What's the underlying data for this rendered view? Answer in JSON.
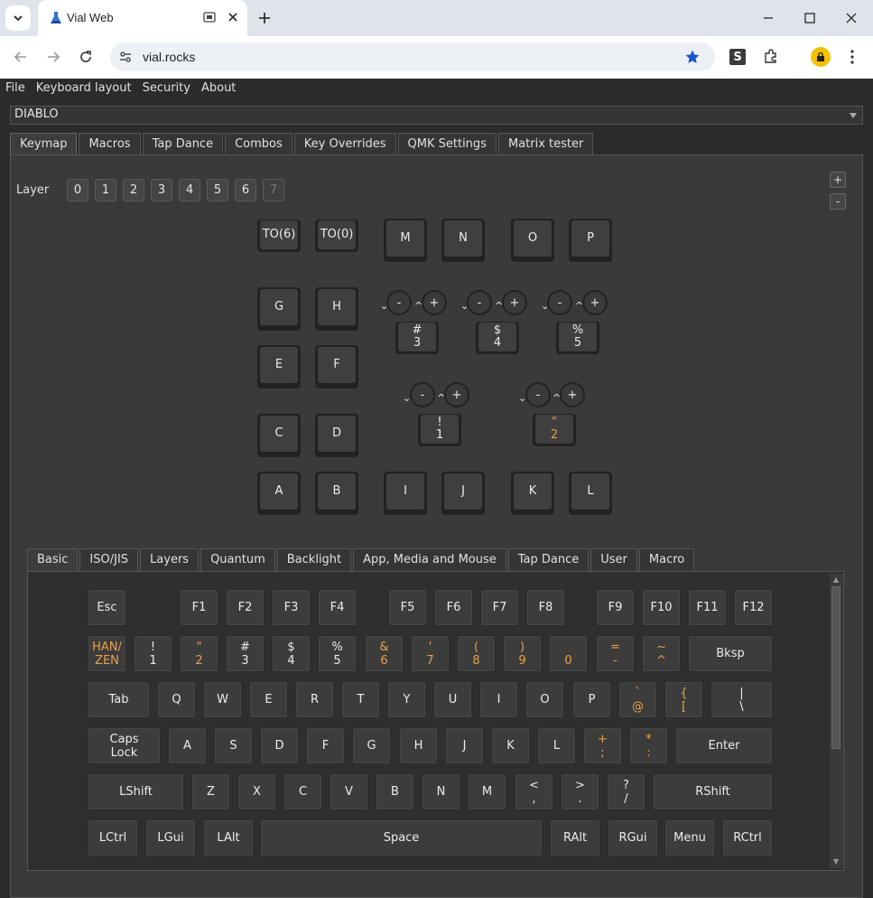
{
  "browser": {
    "tab_title": "Vial Web",
    "url": "vial.rocks"
  },
  "menu": [
    "File",
    "Keyboard layout",
    "Security",
    "About"
  ],
  "device": "DIABLO",
  "main_tabs": [
    "Keymap",
    "Macros",
    "Tap Dance",
    "Combos",
    "Key Overrides",
    "QMK Settings",
    "Matrix tester"
  ],
  "layer": {
    "label": "Layer",
    "buttons": [
      "0",
      "1",
      "2",
      "3",
      "4",
      "5",
      "6",
      "7"
    ],
    "plus": "+",
    "minus": "-"
  },
  "keymap": {
    "to6": "TO(6)",
    "to0": "TO(0)",
    "M": "M",
    "N": "N",
    "O": "O",
    "P": "P",
    "G": "G",
    "H": "H",
    "E": "E",
    "F": "F",
    "C": "C",
    "D": "D",
    "A": "A",
    "B": "B",
    "I": "I",
    "J": "J",
    "K": "K",
    "L": "L",
    "enc_minus": "-",
    "enc_plus": "+",
    "enc3_top": "#",
    "enc3_bot": "3",
    "enc4_top": "$",
    "enc4_bot": "4",
    "enc5_top": "%",
    "enc5_bot": "5",
    "enc1_top": "!",
    "enc1_bot": "1",
    "enc2_top": "\"",
    "enc2_bot": "2"
  },
  "key_tabs": [
    "Basic",
    "ISO/JIS",
    "Layers",
    "Quantum",
    "Backlight",
    "App, Media and Mouse",
    "Tap Dance",
    "User",
    "Macro"
  ],
  "keyboard": {
    "esc": "Esc",
    "f1": "F1",
    "f2": "F2",
    "f3": "F3",
    "f4": "F4",
    "f5": "F5",
    "f6": "F6",
    "f7": "F7",
    "f8": "F8",
    "f9": "F9",
    "f10": "F10",
    "f11": "F11",
    "f12": "F12",
    "hanzen": "HAN/\nZEN",
    "n1": "!\n1",
    "n2": "\"\n2",
    "n3": "#\n3",
    "n4": "$\n4",
    "n5": "%\n5",
    "n6": "&\n6",
    "n7": "'\n7",
    "n8": "(\n8",
    "n9": ")\n9",
    "n0": "0",
    "minus": "=\n-",
    "caret": "~\n^",
    "bksp": "Bksp",
    "tab": "Tab",
    "q": "Q",
    "w": "W",
    "e": "E",
    "r": "R",
    "t": "T",
    "y": "Y",
    "u": "U",
    "i": "I",
    "o": "O",
    "p": "P",
    "at": "`\n@",
    "lbracket": "{\n[",
    "backslash": "|\n\\",
    "caps": "Caps\nLock",
    "a": "A",
    "s": "S",
    "d": "D",
    "f": "F",
    "g": "G",
    "h": "H",
    "j": "J",
    "k": "K",
    "l": "L",
    "semicolon": "+\n;",
    "colon": "*\n:",
    "enter": "Enter",
    "lshift": "LShift",
    "z": "Z",
    "x": "X",
    "c": "C",
    "v": "V",
    "b": "B",
    "n": "N",
    "m": "M",
    "comma": "<\n,",
    "period": ">\n.",
    "slash": "?\n/",
    "rshift": "RShift",
    "lctrl": "LCtrl",
    "lgui": "LGui",
    "lalt": "LAlt",
    "space": "Space",
    "ralt": "RAlt",
    "rgui": "RGui",
    "menu": "Menu",
    "rctrl": "RCtrl"
  },
  "colors": {
    "accent_orange": "#e8a04a",
    "bg": "#2b2b2b"
  }
}
